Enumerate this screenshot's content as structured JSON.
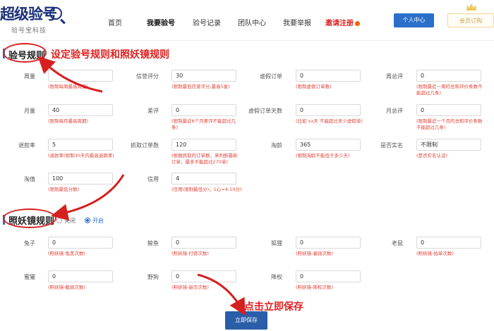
{
  "header": {
    "logo_text": "超级验号",
    "logo_sub": "验号宝科技",
    "nav": [
      "首页",
      "我要验号",
      "验号记录",
      "团队中心",
      "我要举报",
      "邀请注册"
    ],
    "btn_center": "个人中心",
    "btn_vip": "会员订购"
  },
  "section1": {
    "title": "验号规则",
    "annotation": "设定验号规则和照妖镜规则"
  },
  "section2": {
    "title": "照妖镜规则",
    "radio_off": "关闭",
    "radio_on": "开启"
  },
  "rules": [
    {
      "label": "周量",
      "value": "",
      "hint": "(限制每周最高周量)"
    },
    {
      "label": "信誉评分",
      "value": "30",
      "hint": "(限制最低信誉评分,最高5星)"
    },
    {
      "label": "虚假订单",
      "value": "0",
      "hint": "(限制虚假订单数)"
    },
    {
      "label": "周总评",
      "value": "0",
      "hint": "(限制最近一周的总和评价条数不能超过几条)"
    },
    {
      "label": "月量",
      "value": "40",
      "hint": "(限制每月最高周期)"
    },
    {
      "label": "差评",
      "value": "0",
      "hint": "(限制最近6个月差评不能超过几条)"
    },
    {
      "label": "虚假订单天数",
      "value": "0",
      "hint": "(比如 xx天 不能超过多少虚假单)"
    },
    {
      "label": "月总评",
      "value": "0",
      "hint": "(限制最近一个月的总和评价条数不能超过几条)"
    },
    {
      "label": "退款率",
      "value": "5",
      "hint": "(退款率(限制30天内最高退款率)"
    },
    {
      "label": "抓取订单数",
      "value": "120",
      "hint": "(根据抓取的订单数，来判断最新订单，最多不能超过270单)"
    },
    {
      "label": "淘龄",
      "value": "365",
      "hint": "(限制淘龄不能低于多少天)"
    },
    {
      "label": "是否实名",
      "value": "不限制",
      "hint": "(是否实名认证)"
    },
    {
      "label": "淘值",
      "value": "100",
      "hint": "(限制最低分数)"
    },
    {
      "label": "信用",
      "value": "4",
      "hint": "(信用(限制最低分)，1心=4-10分)"
    }
  ],
  "mirror": [
    {
      "label": "兔子",
      "value": "0",
      "hint": "(照妖镜-兔黑次数)"
    },
    {
      "label": "鲸鱼",
      "value": "0",
      "hint": "(照妖镜-打假次数)"
    },
    {
      "label": "狐狸",
      "value": "0",
      "hint": "(照妖镜-骗钱次数)"
    },
    {
      "label": "老鼠",
      "value": "0",
      "hint": "(照妖镜-拍单次数)"
    },
    {
      "label": "蜜獾",
      "value": "0",
      "hint": "(照妖镜-截胡次数)"
    },
    {
      "label": "野狗",
      "value": "0",
      "hint": "(照妖镜-敲诈次数)"
    },
    {
      "label": "降权",
      "value": "0",
      "hint": "(照妖镜-降权次数)"
    }
  ],
  "save": {
    "label": "立即保存",
    "annotation": "点击立即保存"
  },
  "colors": {
    "primary": "#2a6fc9",
    "annotation_red": "#e02020",
    "hint_red": "#e0443a"
  }
}
